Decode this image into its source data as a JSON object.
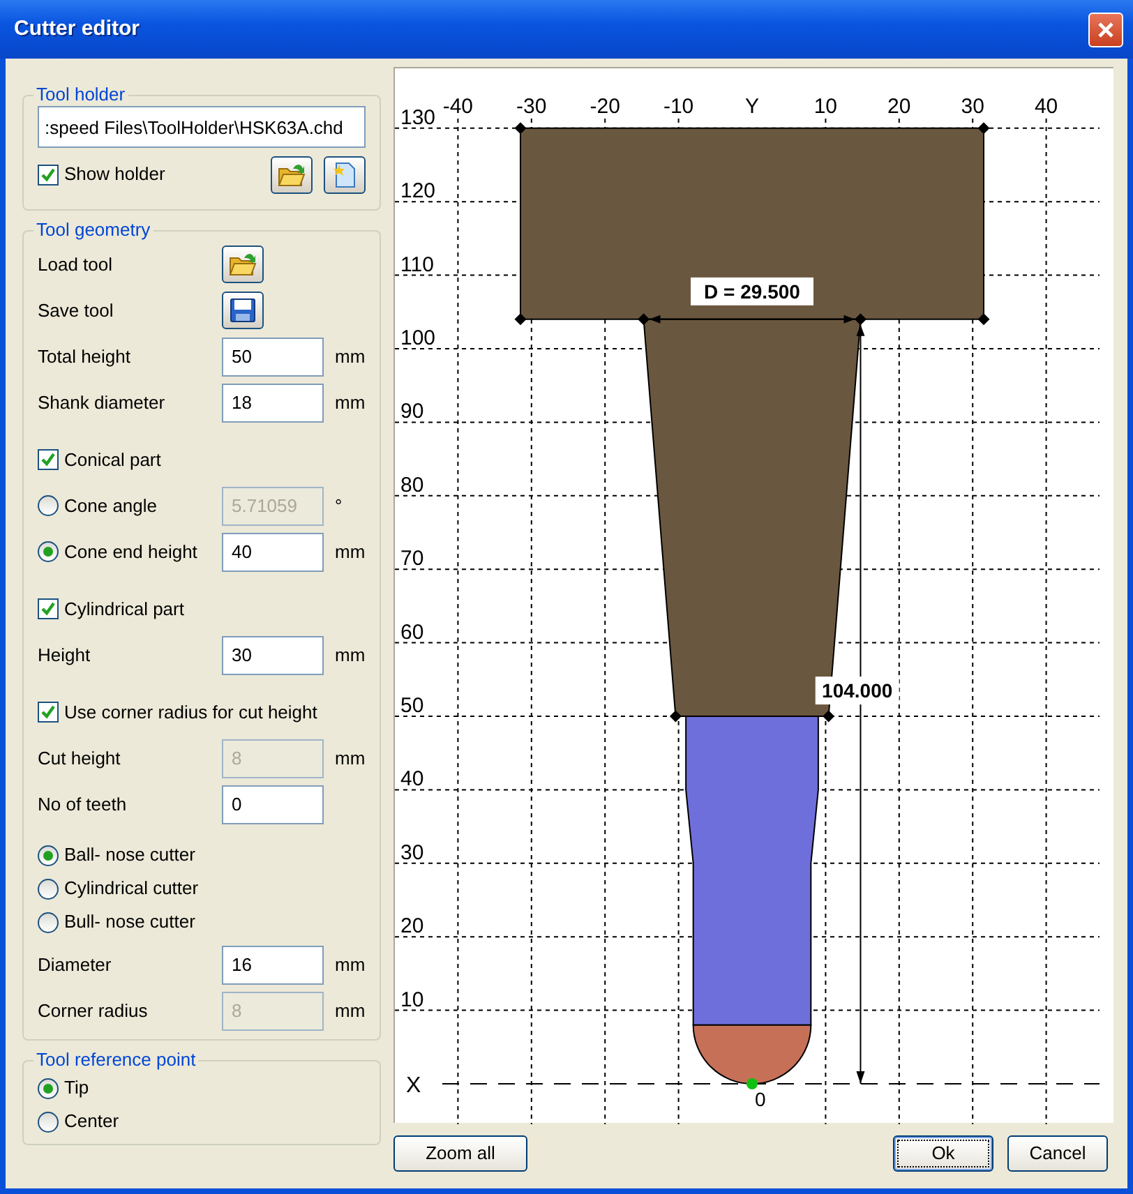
{
  "window": {
    "title": "Cutter editor"
  },
  "tool_holder": {
    "legend": "Tool holder",
    "path": ":speed Files\\ToolHolder\\HSK63A.chd",
    "show_holder": {
      "label": "Show holder",
      "checked": true
    }
  },
  "tool_geometry": {
    "legend": "Tool geometry",
    "rows": [
      {
        "kind": "load",
        "label": "Load tool"
      },
      {
        "kind": "save",
        "label": "Save tool"
      },
      {
        "kind": "field",
        "label": "Total height",
        "value": "50",
        "unit": "mm",
        "disabled": false
      },
      {
        "kind": "field",
        "label": "Shank diameter",
        "value": "18",
        "unit": "mm",
        "disabled": false
      },
      {
        "kind": "checkbox",
        "label": "Conical part",
        "checked": true
      },
      {
        "kind": "radio-field",
        "label": "Cone angle",
        "selected": false,
        "value": "5.71059",
        "unit": "°",
        "disabled": true
      },
      {
        "kind": "radio-field",
        "label": "Cone end height",
        "selected": true,
        "value": "40",
        "unit": "mm",
        "disabled": false
      },
      {
        "kind": "checkbox",
        "label": "Cylindrical part",
        "checked": true
      },
      {
        "kind": "field",
        "label": "Height",
        "value": "30",
        "unit": "mm",
        "disabled": false
      },
      {
        "kind": "checkbox",
        "label": "Use corner radius for cut height",
        "checked": true
      },
      {
        "kind": "field",
        "label": "Cut height",
        "value": "8",
        "unit": "mm",
        "disabled": true
      },
      {
        "kind": "field",
        "label": "No of teeth",
        "value": "0",
        "disabled": false
      },
      {
        "kind": "radio",
        "label": "Ball- nose cutter",
        "selected": true
      },
      {
        "kind": "radio",
        "label": "Cylindrical cutter",
        "selected": false
      },
      {
        "kind": "radio",
        "label": "Bull- nose cutter",
        "selected": false
      },
      {
        "kind": "field",
        "label": "Diameter",
        "value": "16",
        "unit": "mm",
        "disabled": false
      },
      {
        "kind": "field",
        "label": "Corner radius",
        "value": "8",
        "unit": "mm",
        "disabled": true
      }
    ]
  },
  "reference_point": {
    "legend": "Tool reference point",
    "options": [
      {
        "label": "Tip",
        "selected": true
      },
      {
        "label": "Center",
        "selected": false
      }
    ]
  },
  "canvas": {
    "x_tick_labels": [
      "-40",
      "-30",
      "-20",
      "-10",
      "Y",
      "10",
      "20",
      "30",
      "40"
    ],
    "y_tick_labels": [
      "130",
      "120",
      "110",
      "100",
      "90",
      "80",
      "70",
      "60",
      "50",
      "40",
      "30",
      "20",
      "10"
    ],
    "x_axis_label": "X",
    "origin_label": "0",
    "diameter_dimension": "D = 29.500",
    "height_dimension": "104.000"
  },
  "buttons": [
    {
      "kind": "zoom",
      "label": "Zoom all",
      "default": false
    },
    {
      "kind": "ok",
      "label": "Ok",
      "default": true
    },
    {
      "kind": "cancel",
      "label": "Cancel",
      "default": false
    }
  ]
}
